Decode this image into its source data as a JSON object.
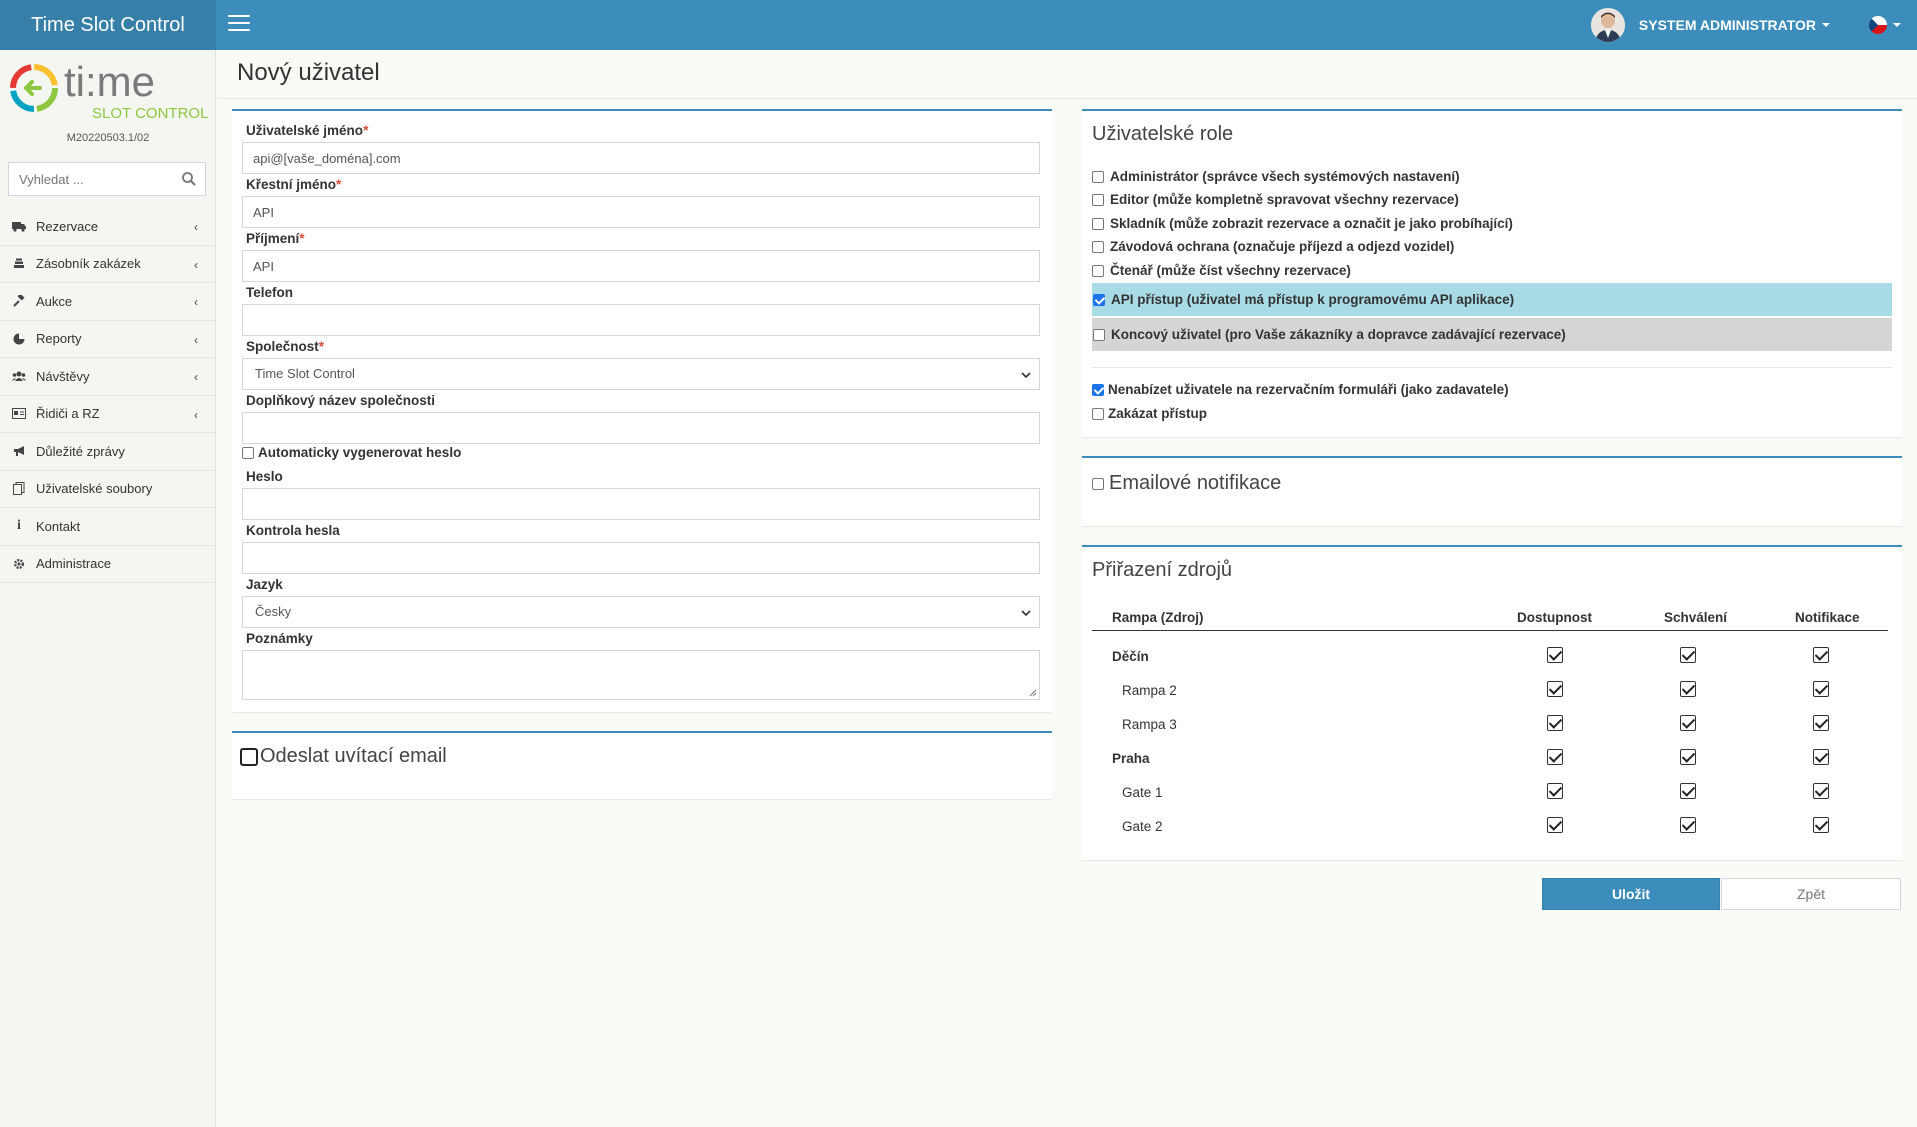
{
  "app": {
    "title": "Time Slot Control",
    "version": "M20220503.1/02",
    "logo_text": "ti:me",
    "logo_sub": "SLOT CONTROL"
  },
  "header": {
    "user_name": "SYSTEM ADMINISTRATOR"
  },
  "sidebar": {
    "search_placeholder": "Vyhledat ...",
    "items": [
      {
        "label": "Rezervace",
        "icon": "truck-icon",
        "has_submenu": true
      },
      {
        "label": "Zásobník zakázek",
        "icon": "stack-icon",
        "has_submenu": true
      },
      {
        "label": "Aukce",
        "icon": "gavel-icon",
        "has_submenu": true
      },
      {
        "label": "Reporty",
        "icon": "pie-chart-icon",
        "has_submenu": true
      },
      {
        "label": "Návštěvy",
        "icon": "users-icon",
        "has_submenu": true
      },
      {
        "label": "Řidiči a RZ",
        "icon": "id-card-icon",
        "has_submenu": true
      },
      {
        "label": "Důležité zprávy",
        "icon": "megaphone-icon",
        "has_submenu": false
      },
      {
        "label": "Uživatelské soubory",
        "icon": "files-icon",
        "has_submenu": false
      },
      {
        "label": "Kontakt",
        "icon": "info-icon",
        "has_submenu": false
      },
      {
        "label": "Administrace",
        "icon": "gear-icon",
        "has_submenu": false
      }
    ]
  },
  "page": {
    "title": "Nový uživatel"
  },
  "form": {
    "username_label": "Uživatelské jméno",
    "username_value": "api@[vaše_doména].com",
    "firstname_label": "Křestní jméno",
    "firstname_value": "API",
    "lastname_label": "Příjmení",
    "lastname_value": "API",
    "phone_label": "Telefon",
    "phone_value": "",
    "company_label": "Společnost",
    "company_value": "Time Slot Control",
    "company_extra_label": "Doplňkový název společnosti",
    "company_extra_value": "",
    "autogen_label": "Automaticky vygenerovat heslo",
    "password_label": "Heslo",
    "password_confirm_label": "Kontrola hesla",
    "language_label": "Jazyk",
    "language_value": "Česky",
    "notes_label": "Poznámky",
    "welcome_email_label": "Odeslat uvítací email"
  },
  "roles": {
    "title": "Uživatelské role",
    "items": [
      {
        "label": "Administrátor (správce všech systémových nastavení)",
        "checked": false
      },
      {
        "label": "Editor (může kompletně spravovat všechny rezervace)",
        "checked": false
      },
      {
        "label": "Skladník (může zobrazit rezervace a označit je jako probíhající)",
        "checked": false
      },
      {
        "label": "Závodová ochrana (označuje příjezd a odjezd vozidel)",
        "checked": false
      },
      {
        "label": "Čtenář (může číst všechny rezervace)",
        "checked": false
      },
      {
        "label": "API přístup (uživatel má přístup k programovému API aplikace)",
        "checked": true
      },
      {
        "label": "Koncový uživatel (pro Vaše zákazníky a dopravce zadávající rezervace)",
        "checked": false
      }
    ],
    "hide_label": "Nenabízet uživatele na rezervačním formuláři (jako zadavatele)",
    "hide_checked": true,
    "block_label": "Zakázat přístup",
    "block_checked": false,
    "colors": {
      "api_highlight": "#a8dbe6",
      "enduser_highlight": "#d5d5d3"
    }
  },
  "email_notifications": {
    "title": "Emailové notifikace"
  },
  "resources": {
    "title": "Přiřazení zdrojů",
    "columns": [
      "Rampa (Zdroj)",
      "Dostupnost",
      "Schválení",
      "Notifikace"
    ],
    "rows": [
      {
        "name": "Děčín",
        "group": true,
        "availability": true,
        "approval": true,
        "notification": true
      },
      {
        "name": "Rampa 2",
        "group": false,
        "availability": true,
        "approval": true,
        "notification": true
      },
      {
        "name": "Rampa 3",
        "group": false,
        "availability": true,
        "approval": true,
        "notification": true
      },
      {
        "name": "Praha",
        "group": true,
        "availability": true,
        "approval": true,
        "notification": true
      },
      {
        "name": "Gate 1",
        "group": false,
        "availability": true,
        "approval": true,
        "notification": true
      },
      {
        "name": "Gate 2",
        "group": false,
        "availability": true,
        "approval": true,
        "notification": true
      }
    ]
  },
  "actions": {
    "save_label": "Uložit",
    "back_label": "Zpět"
  },
  "colors": {
    "primary": "#3c8dbc",
    "brand_dark": "#367fa9",
    "required": "#dd4b39"
  }
}
